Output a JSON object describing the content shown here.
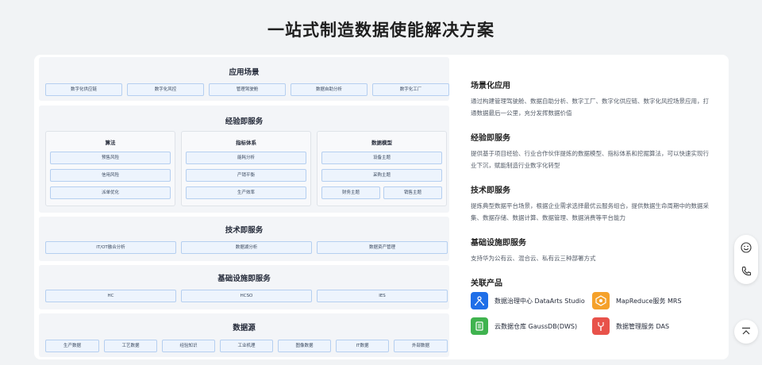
{
  "page_title": "一站式制造数据使能解决方案",
  "architecture": {
    "scenarios": {
      "title": "应用场景",
      "items": [
        "数字化供应链",
        "数字化风控",
        "管理驾驶舱",
        "数据自助分析",
        "数字化工厂"
      ]
    },
    "experience": {
      "title": "经验即服务",
      "groups": [
        {
          "title": "算法",
          "items": [
            "预售风险",
            "信用风险",
            "派单优化"
          ]
        },
        {
          "title": "指标体系",
          "items": [
            "能耗分析",
            "产销平衡",
            "生产效率"
          ]
        },
        {
          "title": "数据模型",
          "items": [
            "设备主题",
            "采购主题",
            "财务主题",
            "销售主题"
          ]
        }
      ]
    },
    "technology": {
      "title": "技术即服务",
      "items": [
        "IT/OT融合分析",
        "数据湖分析",
        "数据资产管理"
      ]
    },
    "infrastructure": {
      "title": "基础设施即服务",
      "items": [
        "HC",
        "HCSO",
        "IES"
      ]
    },
    "sources": {
      "title": "数据源",
      "items": [
        "生产数据",
        "工艺数据",
        "经验知识",
        "工业机理",
        "图像数据",
        "IT数据",
        "外部数据"
      ]
    }
  },
  "descriptions": [
    {
      "title": "场景化应用",
      "text": "通过构建管理驾驶舱、数据自助分析、数字工厂、数字化供应链、数字化风控场景应用，打通数据最后一公里，充分发挥数据价值"
    },
    {
      "title": "经验即服务",
      "text": "提供基于项目经验、行业合作伙伴提炼的数据模型、指标体系和挖掘算法，可以快速实现行业下沉，赋能制造行业数字化转型"
    },
    {
      "title": "技术即服务",
      "text": "提炼典型数据平台场景，根据企业需求选择最优云服务组合，提供数据生命周期中的数据采集、数据存储、数据计算、数据管理、数据消费等平台能力"
    },
    {
      "title": "基础设施即服务",
      "text": "支持华为公有云、混合云、私有云三种部署方式"
    }
  ],
  "related": {
    "title": "关联产品",
    "products": [
      {
        "label": "数据治理中心 DataArts Studio",
        "icon": "dataarts-icon",
        "color": "#1f6fe8"
      },
      {
        "label": "MapReduce服务 MRS",
        "icon": "mrs-icon",
        "color": "#f5a12a"
      },
      {
        "label": "云数据仓库 GaussDB(DWS)",
        "icon": "dws-icon",
        "color": "#3fb34f"
      },
      {
        "label": "数据管理服务 DAS",
        "icon": "das-icon",
        "color": "#e8524a"
      }
    ]
  },
  "floating": {
    "feedback_icon": "smile-icon",
    "phone_icon": "phone-icon",
    "top_icon": "back-to-top-icon"
  },
  "colors": {
    "chip_bg": "#edf4fd",
    "chip_border": "#b5cff0",
    "layer_bg": "#f3f5f8"
  }
}
